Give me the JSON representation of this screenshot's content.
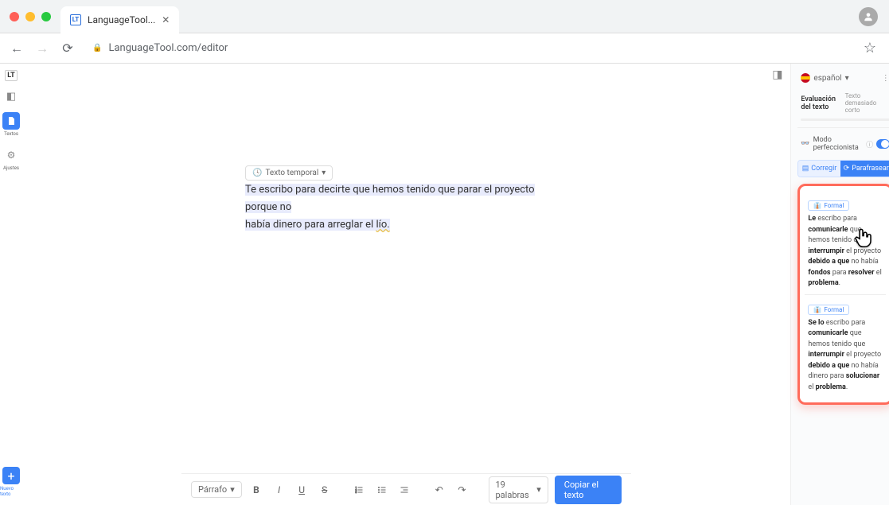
{
  "browser": {
    "tab_title": "LanguageTool...",
    "url": "LanguageTool.com/editor"
  },
  "left_rail": {
    "logo": "LT",
    "textos_label": "Textos",
    "ajustes_label": "Ajustes",
    "new_text_label": "Nuevo texto"
  },
  "editor": {
    "temp_chip": "Texto temporal",
    "content_part1": "Te escribo para decirte que hemos tenido que parar el proyecto porque no",
    "content_part2": "había dinero para arreglar el ",
    "content_err": "lío."
  },
  "toolbar": {
    "paragraph": "Párrafo",
    "word_count": "19 palabras",
    "copy_label": "Copiar el texto"
  },
  "sidebar": {
    "language": "español",
    "eval_title": "Evaluación del texto",
    "eval_status": "Texto demasiado corto",
    "perf_mode": "Modo perfeccionista",
    "mode_correct": "Corregir",
    "mode_paraphrase": "Parafrasear",
    "suggestions": [
      {
        "badge": "Formal",
        "html": "<b>Le</b> escribo para <b>comunicarle</b> que hemos tenido que <b>interrumpir</b> el proyecto <b>debido a que</b> no había <b>fondos</b> para <b>resolver</b> el <b>problema</b>."
      },
      {
        "badge": "Formal",
        "html": "<b>Se lo</b> escribo para <b>comunicarle</b> que hemos tenido que <b>interrumpir</b> el proyecto <b>debido a que</b> no había dinero para <b>solucionar</b> el <b>problema</b>."
      }
    ]
  }
}
